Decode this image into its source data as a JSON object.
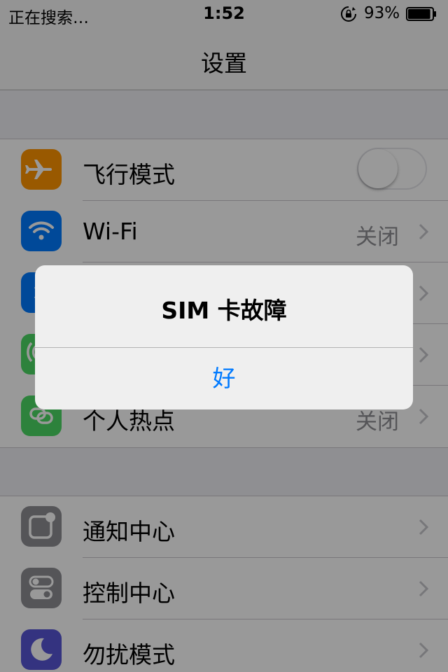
{
  "status_bar": {
    "carrier": "正在搜索…",
    "time": "1:52",
    "battery_percent": "93%",
    "battery_level": 0.93
  },
  "nav": {
    "title": "设置"
  },
  "group1": [
    {
      "label": "飞行模式",
      "icon": "airplane-icon",
      "color": "#ff9500",
      "control": "toggle",
      "toggle_on": false
    },
    {
      "label": "Wi-Fi",
      "icon": "wifi-icon",
      "color": "#007aff",
      "value": "关闭"
    },
    {
      "label": "",
      "icon": "bluetooth-icon",
      "color": "#007aff",
      "value": ""
    },
    {
      "label": "",
      "icon": "cellular-icon",
      "color": "#4cd964",
      "value": ""
    },
    {
      "label": "个人热点",
      "icon": "hotspot-icon",
      "color": "#4cd964",
      "value": "关闭"
    }
  ],
  "group2": [
    {
      "label": "通知中心",
      "icon": "notification-center-icon",
      "color": "#8e8e93"
    },
    {
      "label": "控制中心",
      "icon": "control-center-icon",
      "color": "#8e8e93"
    },
    {
      "label": "勿扰模式",
      "icon": "do-not-disturb-icon",
      "color": "#5856d6"
    }
  ],
  "alert": {
    "title": "SIM 卡故障",
    "button": "好",
    "button_color": "#007aff"
  }
}
